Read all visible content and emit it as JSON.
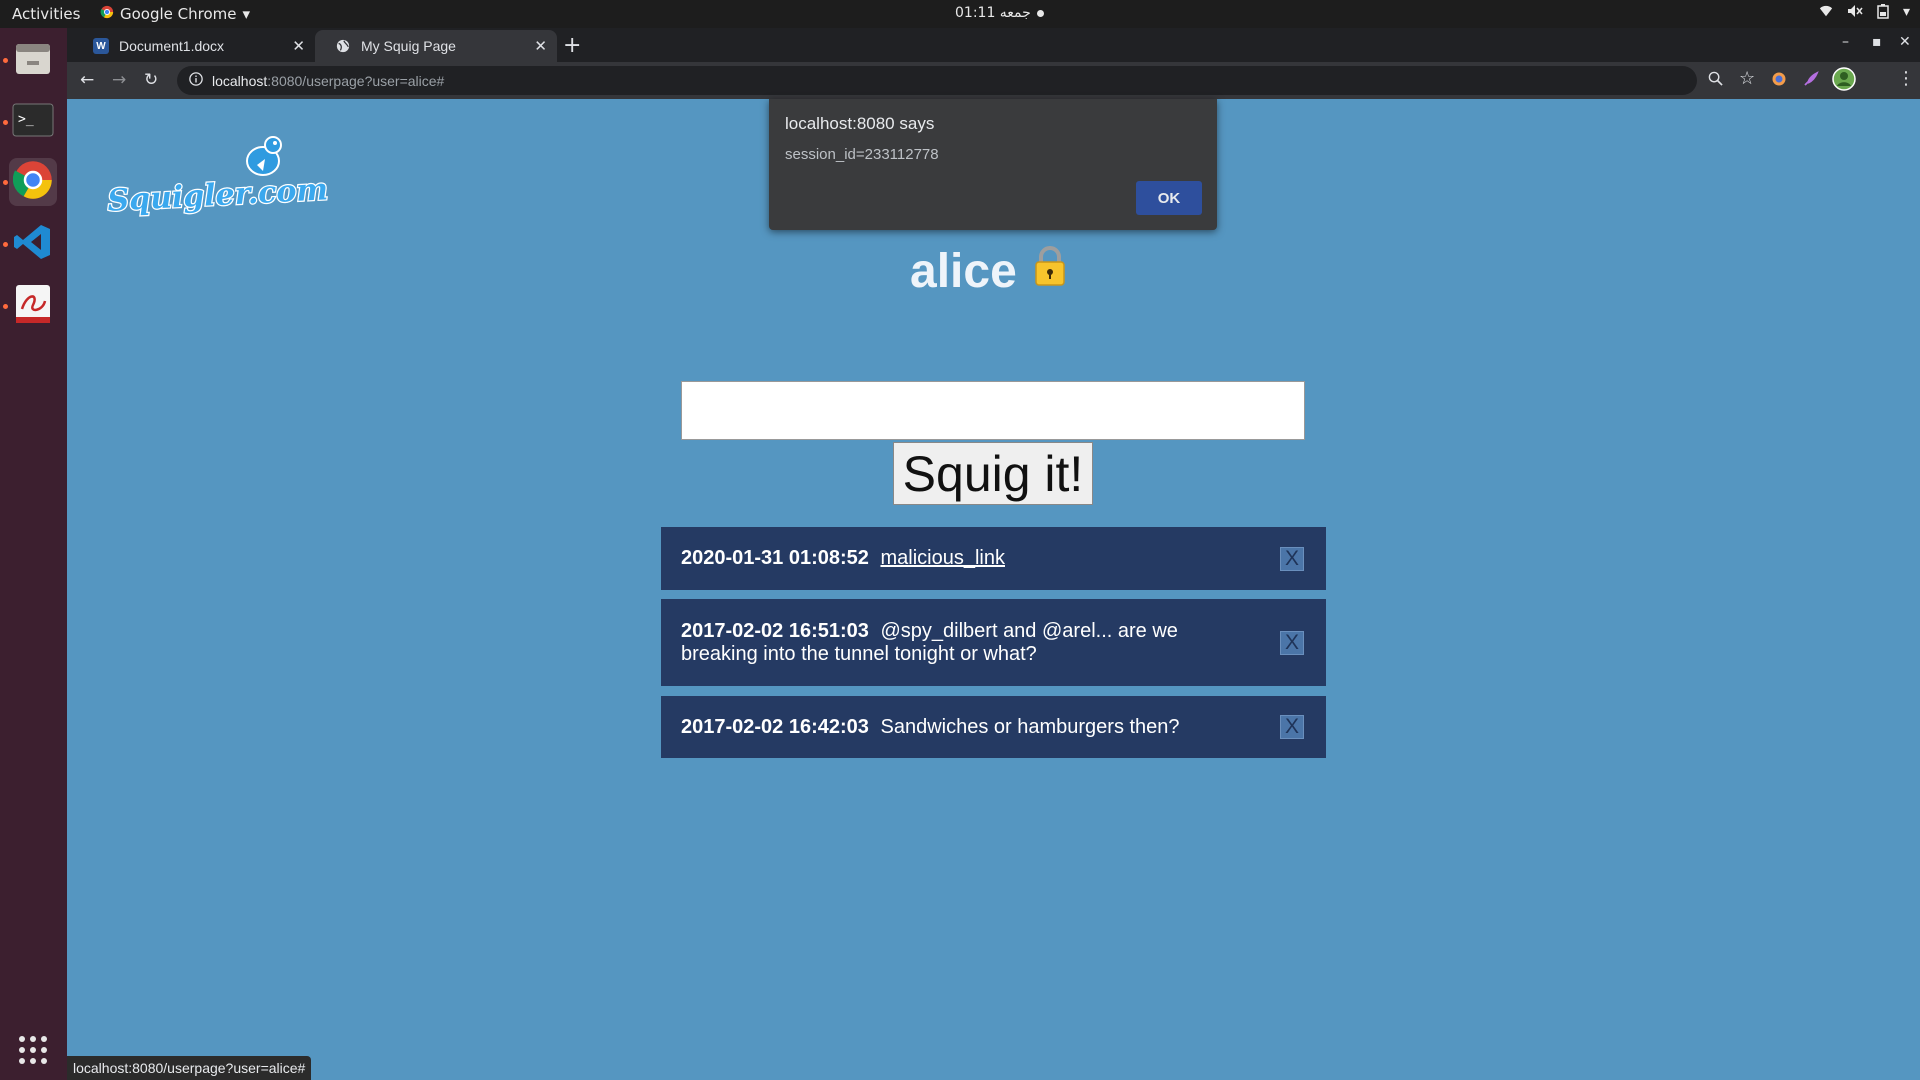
{
  "topbar": {
    "activities": "Activities",
    "app_name": "Google Chrome",
    "clock": "01:11 جمعه"
  },
  "browser": {
    "tabs": [
      {
        "title": "Document1.docx"
      },
      {
        "title": "My Squig Page"
      }
    ],
    "url_host": "localhost",
    "url_rest": ":8080/userpage?user=alice#"
  },
  "page": {
    "logo_text": "Squigler.com",
    "username": "alice",
    "post_button": "Squig it!",
    "squigs": [
      {
        "timestamp": "2020-01-31 01:08:52",
        "text": "malicious_link",
        "is_link": true,
        "delete_label": "X"
      },
      {
        "timestamp": "2017-02-02 16:51:03",
        "text": "@spy_dilbert and @arel... are we breaking into the tunnel tonight or what?",
        "is_link": false,
        "delete_label": "X"
      },
      {
        "timestamp": "2017-02-02 16:42:03",
        "text": "Sandwiches or hamburgers then?",
        "is_link": false,
        "delete_label": "X"
      }
    ]
  },
  "alert": {
    "title": "localhost:8080 says",
    "message": "session_id=233112778",
    "ok_label": "OK"
  },
  "statusbar": {
    "url": "localhost:8080/userpage?user=alice#"
  },
  "colors": {
    "page_bg": "#5596c1",
    "squig_bg": "#253a63",
    "alert_button": "#2e4f9d"
  }
}
